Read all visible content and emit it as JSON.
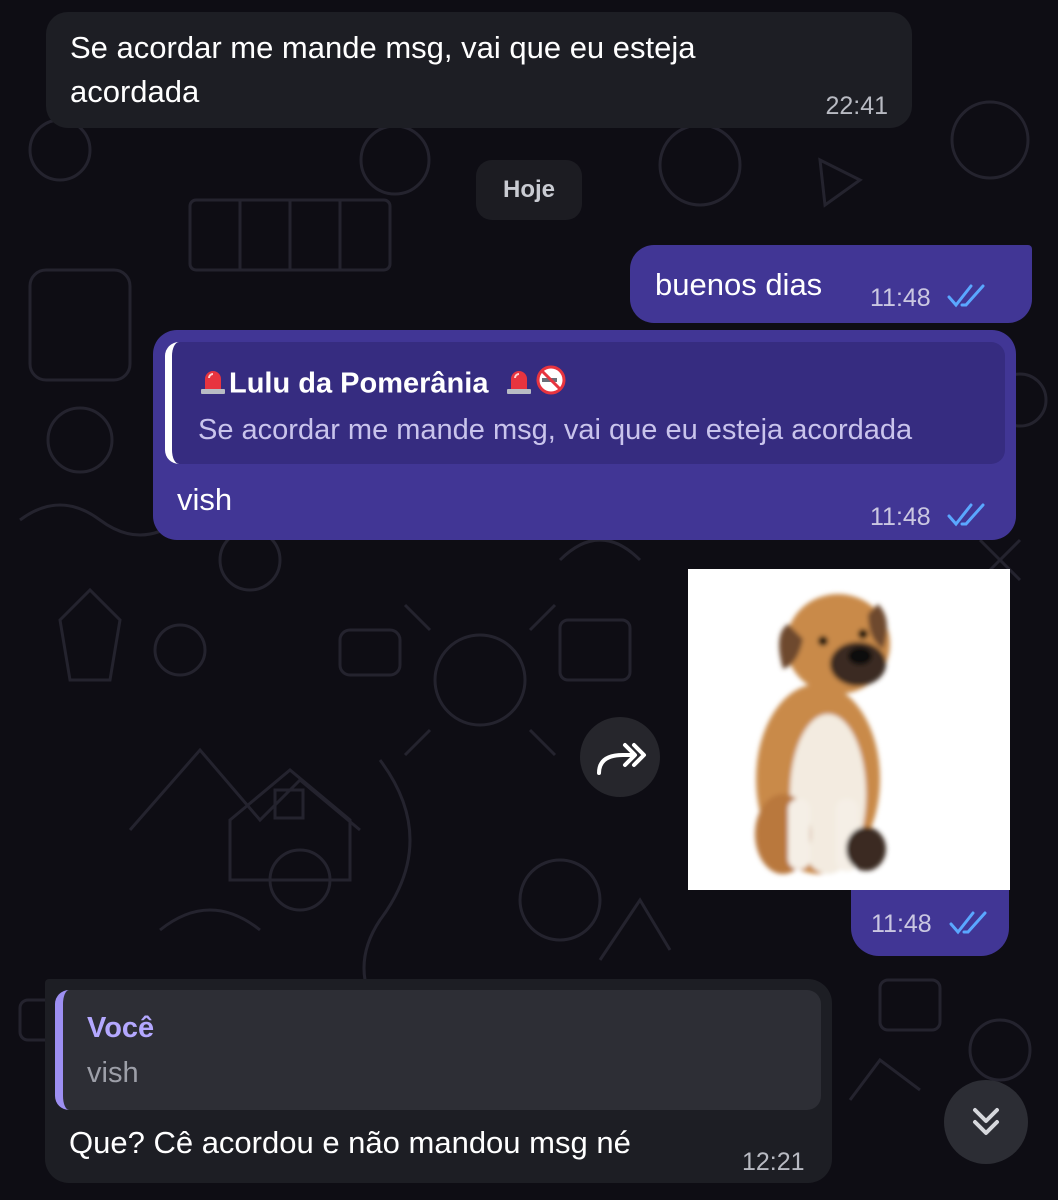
{
  "messages": [
    {
      "text": "Se acordar me mande msg, vai que eu esteja acordada",
      "time": "22:41"
    },
    {
      "text": "buenos dias",
      "time": "11:48"
    },
    {
      "reply_author": "Lulu da Pomerânia",
      "reply_text": "Se acordar me mande msg, vai que eu esteja acordada",
      "text": "vish",
      "time": "11:48"
    },
    {
      "time": "11:48"
    },
    {
      "reply_author": "Você",
      "reply_text": "vish",
      "text": "Que? Cê acordou e não mandou msg né",
      "time": "12:21"
    }
  ],
  "date_separator": "Hoje",
  "icons": {
    "read_receipt": "double-check-icon",
    "forward": "forward-icon",
    "scroll_down": "double-chevron-down-icon",
    "siren": "siren-emoji-icon",
    "no_smoking": "no-smoking-emoji-icon"
  },
  "colors": {
    "background": "#0e0d14",
    "incoming_bubble": "#1d1e24",
    "outgoing_bubble": "#413695",
    "read_ticks": "#5aa7ff",
    "reply_accent": "#9d8ff2"
  }
}
